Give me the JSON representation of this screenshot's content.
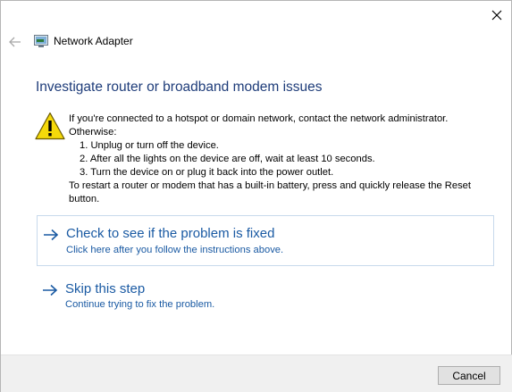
{
  "window": {
    "close_icon": "close-icon",
    "back_icon": "back-arrow-icon"
  },
  "header": {
    "icon": "network-adapter-icon",
    "title": "Network Adapter"
  },
  "main": {
    "title": "Investigate router or broadband modem issues",
    "warning_icon": "warning-icon",
    "instructions": {
      "intro": "If you're connected to a hotspot or domain network, contact the network administrator.",
      "otherwise": "Otherwise:",
      "steps": [
        "1.  Unplug or turn off the device.",
        "2.  After all the lights on the device are off, wait at least 10 seconds.",
        "3.  Turn the device on or plug it back into the power outlet."
      ],
      "reset_note": "To restart a router or modem that has a built-in battery, press and quickly release the Reset button."
    },
    "options": [
      {
        "title": "Check to see if the problem is fixed",
        "subtitle": "Click here after you follow the instructions above."
      },
      {
        "title": "Skip this step",
        "subtitle": "Continue trying to fix the problem."
      }
    ]
  },
  "footer": {
    "cancel_label": "Cancel"
  },
  "colors": {
    "title_blue": "#1f3d7a",
    "link_blue": "#1a5aa3",
    "warning_yellow": "#f5d90a"
  }
}
